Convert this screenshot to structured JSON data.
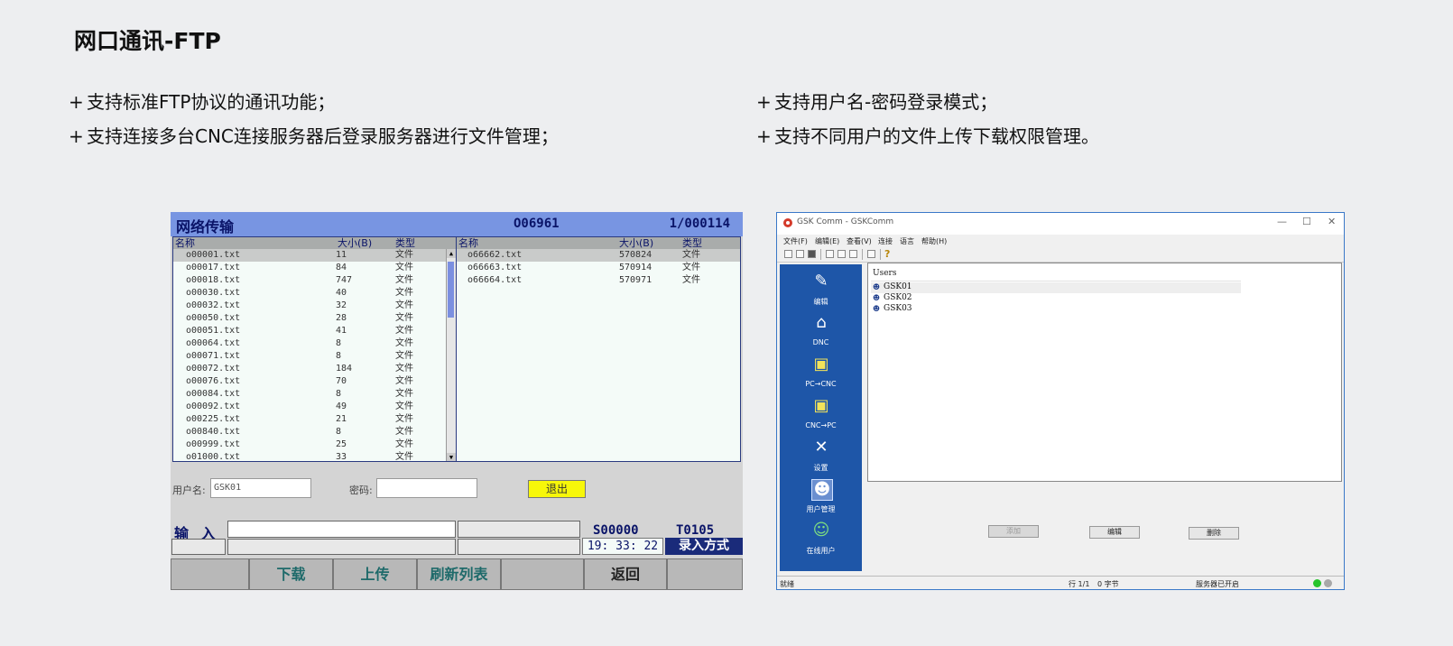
{
  "slide": {
    "title": "网口通讯-FTP",
    "bullets_left": [
      "支持标准FTP协议的通讯功能；",
      "支持连接多台CNC连接服务器后登录服务器进行文件管理；"
    ],
    "bullets_right": [
      "支持用户名-密码登录模式；",
      "支持不同用户的文件上传下载权限管理。"
    ],
    "bullet_marker": "+"
  },
  "cnc": {
    "header": {
      "title": "网络传输",
      "program": "O06961",
      "count": "1/000114"
    },
    "columns": {
      "name": "名称",
      "size": "大小(B)",
      "type": "类型"
    },
    "left_files": [
      {
        "name": "o00001.txt",
        "size": "11",
        "type": "文件"
      },
      {
        "name": "o00017.txt",
        "size": "84",
        "type": "文件"
      },
      {
        "name": "o00018.txt",
        "size": "747",
        "type": "文件"
      },
      {
        "name": "o00030.txt",
        "size": "40",
        "type": "文件"
      },
      {
        "name": "o00032.txt",
        "size": "32",
        "type": "文件"
      },
      {
        "name": "o00050.txt",
        "size": "28",
        "type": "文件"
      },
      {
        "name": "o00051.txt",
        "size": "41",
        "type": "文件"
      },
      {
        "name": "o00064.txt",
        "size": "8",
        "type": "文件"
      },
      {
        "name": "o00071.txt",
        "size": "8",
        "type": "文件"
      },
      {
        "name": "o00072.txt",
        "size": "184",
        "type": "文件"
      },
      {
        "name": "o00076.txt",
        "size": "70",
        "type": "文件"
      },
      {
        "name": "o00084.txt",
        "size": "8",
        "type": "文件"
      },
      {
        "name": "o00092.txt",
        "size": "49",
        "type": "文件"
      },
      {
        "name": "o00225.txt",
        "size": "21",
        "type": "文件"
      },
      {
        "name": "o00840.txt",
        "size": "8",
        "type": "文件"
      },
      {
        "name": "o00999.txt",
        "size": "25",
        "type": "文件"
      },
      {
        "name": "o01000.txt",
        "size": "33",
        "type": "文件"
      }
    ],
    "right_files": [
      {
        "name": "o66662.txt",
        "size": "570824",
        "type": "文件"
      },
      {
        "name": "o66663.txt",
        "size": "570914",
        "type": "文件"
      },
      {
        "name": "o66664.txt",
        "size": "570971",
        "type": "文件"
      }
    ],
    "login": {
      "user_label": "用户名:",
      "user_value": "GSK01",
      "pass_label": "密码:",
      "exit": "退出"
    },
    "input_label": "输 入",
    "s_value": "S00000",
    "t_value": "T0105",
    "time": "19: 33: 22",
    "mode": "录入方式",
    "softkeys": [
      "",
      "下载",
      "上传",
      "刷新列表",
      "",
      "返回",
      ""
    ]
  },
  "gsk": {
    "title": "GSK Comm - GSKComm",
    "controls": [
      "—",
      "☐",
      "✕"
    ],
    "menu": [
      "文件(F)",
      "编辑(E)",
      "查看(V)",
      "连接",
      "语言",
      "帮助(H)"
    ],
    "side_items": [
      {
        "label": "编辑",
        "icon": "✎"
      },
      {
        "label": "DNC",
        "icon": "⌂"
      },
      {
        "label": "PC→CNC",
        "icon": "▣"
      },
      {
        "label": "CNC→PC",
        "icon": "▣"
      },
      {
        "label": "设置",
        "icon": "✕"
      },
      {
        "label": "用户管理",
        "icon": "☻"
      },
      {
        "label": "在线用户",
        "icon": "☺"
      }
    ],
    "users_header": "Users",
    "users": [
      "GSK01",
      "GSK02",
      "GSK03"
    ],
    "buttons": {
      "add": "添加",
      "edit": "编辑",
      "delete": "删除"
    },
    "status": {
      "ready": "就绪",
      "line": "行 1/1",
      "bytes": "0 字节",
      "server": "服务器已开启"
    },
    "colors": {
      "sidebar": "#1e56a8",
      "cnc_header": "#7895e2",
      "exit_button": "#f7f709"
    }
  }
}
